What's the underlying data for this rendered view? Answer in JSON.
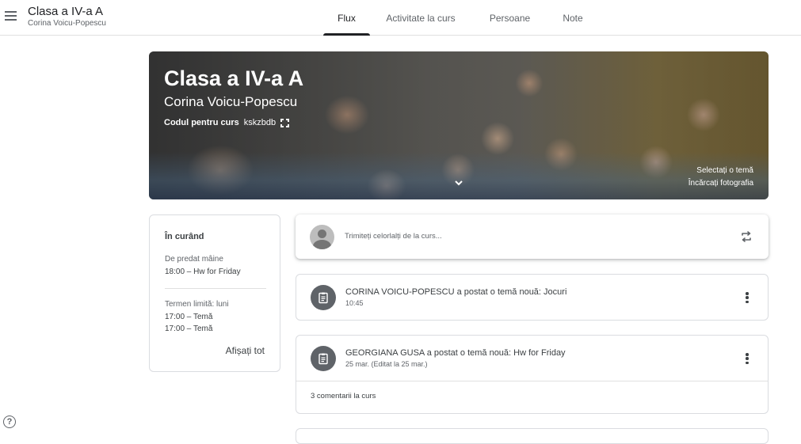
{
  "header": {
    "class_name": "Clasa a IV-a A",
    "teacher": "Corina Voicu-Popescu",
    "tabs": [
      {
        "label": "Flux",
        "active": true
      },
      {
        "label": "Activitate la curs",
        "active": false
      },
      {
        "label": "Persoane",
        "active": false
      },
      {
        "label": "Note",
        "active": false
      }
    ]
  },
  "banner": {
    "title": "Clasa a IV-a A",
    "teacher": "Corina Voicu-Popescu",
    "code_label": "Codul pentru curs",
    "code_value": "kskzbdb",
    "select_theme": "Selectați o temă",
    "upload_photo": "Încărcați fotografia"
  },
  "upcoming": {
    "title": "În curând",
    "due_tomorrow_label": "De predat mâine",
    "due_tomorrow_item": "18:00 – Hw for Friday",
    "due_monday_label": "Termen limită: luni",
    "due_monday_items": [
      "17:00 – Temă",
      "17:00 – Temă"
    ],
    "view_all": "Afișați tot"
  },
  "share": {
    "placeholder": "Trimiteți celorlalți de la curs..."
  },
  "posts": [
    {
      "title": "CORINA VOICU-POPESCU a postat o temă nouă: Jocuri",
      "time": "10:45"
    },
    {
      "title": "GEORGIANA GUSA a postat o temă nouă: Hw for Friday",
      "time": "25 mar. (Editat la 25 mar.)",
      "comments": "3 comentarii la curs"
    }
  ],
  "icons": {
    "menu": "menu-icon",
    "help": "help-icon",
    "fullscreen": "fullscreen-icon",
    "repost": "repost-icon",
    "assignment": "assignment-icon",
    "more": "more-vert-icon",
    "chevron": "chevron-down-icon"
  }
}
